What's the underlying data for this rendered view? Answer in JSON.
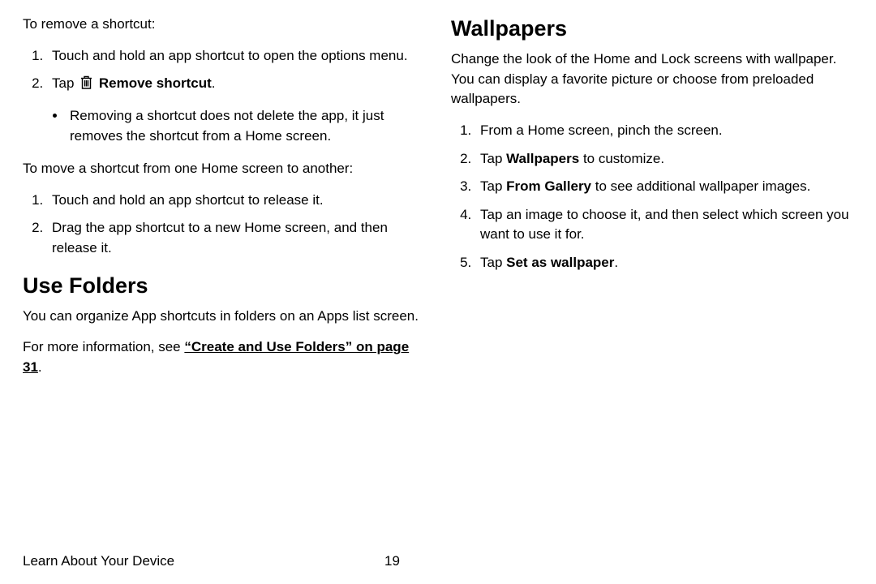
{
  "left": {
    "remove_intro": "To remove a shortcut:",
    "remove_step1": "Touch and hold an app shortcut to open the options menu.",
    "remove_step2_pre": "Tap ",
    "remove_step2_bold": "Remove shortcut",
    "remove_step2_post": ".",
    "remove_bullet": "Removing a shortcut does not delete the app, it just removes the shortcut from a Home screen.",
    "move_intro": "To move a shortcut from one Home screen to another:",
    "move_step1": "Touch and hold an app shortcut to release it.",
    "move_step2": "Drag the app shortcut to a new Home screen, and then release it.",
    "folders_heading": "Use Folders",
    "folders_p1": "You can organize App shortcuts in folders on an Apps list screen.",
    "folders_p2_pre": "For more information, see ",
    "folders_link": "“Create and Use Folders” on page 31",
    "folders_p2_post": "."
  },
  "right": {
    "wall_heading": "Wallpapers",
    "wall_intro": "Change the look of the Home and Lock screens with wallpaper. You can display a favorite picture or choose from preloaded wallpapers.",
    "wall_step1": "From a Home screen, pinch the screen.",
    "wall_step2_pre": "Tap ",
    "wall_step2_bold": "Wallpapers",
    "wall_step2_post": " to customize.",
    "wall_step3_pre": "Tap ",
    "wall_step3_bold": "From Gallery",
    "wall_step3_post": " to see additional wallpaper images.",
    "wall_step4": "Tap an image to choose it, and then select which screen you want to use it for.",
    "wall_step5_pre": "Tap ",
    "wall_step5_bold": "Set as wallpaper",
    "wall_step5_post": "."
  },
  "footer": {
    "section": "Learn About Your Device",
    "page": "19"
  },
  "icons": {
    "trash": "trash-icon"
  }
}
